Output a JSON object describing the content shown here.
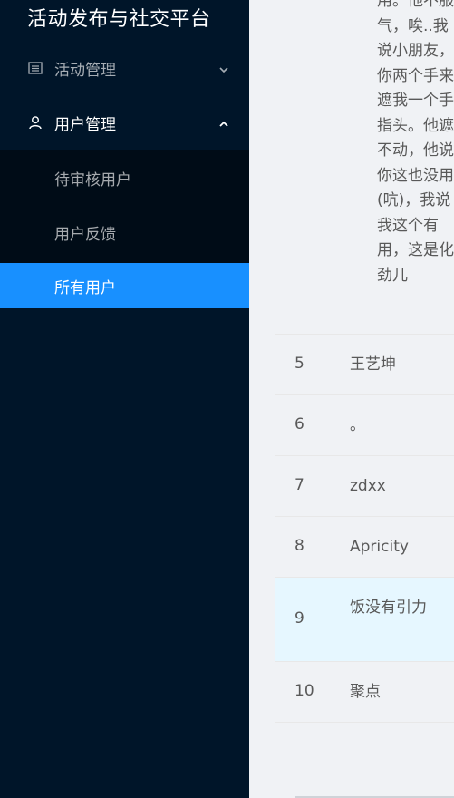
{
  "app": {
    "title": "活动发布与社交平台"
  },
  "sidebar": {
    "activity_menu": {
      "label": "活动管理",
      "icon": "list-icon"
    },
    "user_menu": {
      "label": "用户管理",
      "icon": "user-icon",
      "items": [
        {
          "label": "待审核用户"
        },
        {
          "label": "用户反馈"
        },
        {
          "label": "所有用户",
          "active": true
        }
      ]
    }
  },
  "table": {
    "overflow_text": "用。他不服气，唉..我说小朋友，你两个手来遮我一个手指头。他遮不动，他说你这也没用(吭)，我说我这个有用，这是化劲儿",
    "rows": [
      {
        "index": "5",
        "name": "王艺坤"
      },
      {
        "index": "6",
        "name": "。"
      },
      {
        "index": "7",
        "name": "zdxx"
      },
      {
        "index": "8",
        "name": "Apricity"
      },
      {
        "index": "9",
        "name": "饭没有引力"
      },
      {
        "index": "10",
        "name": "聚点"
      }
    ]
  },
  "colors": {
    "sidebar_bg": "#001529",
    "submenu_bg": "#000c17",
    "accent": "#1890ff",
    "row_highlight": "#e6f7ff"
  }
}
